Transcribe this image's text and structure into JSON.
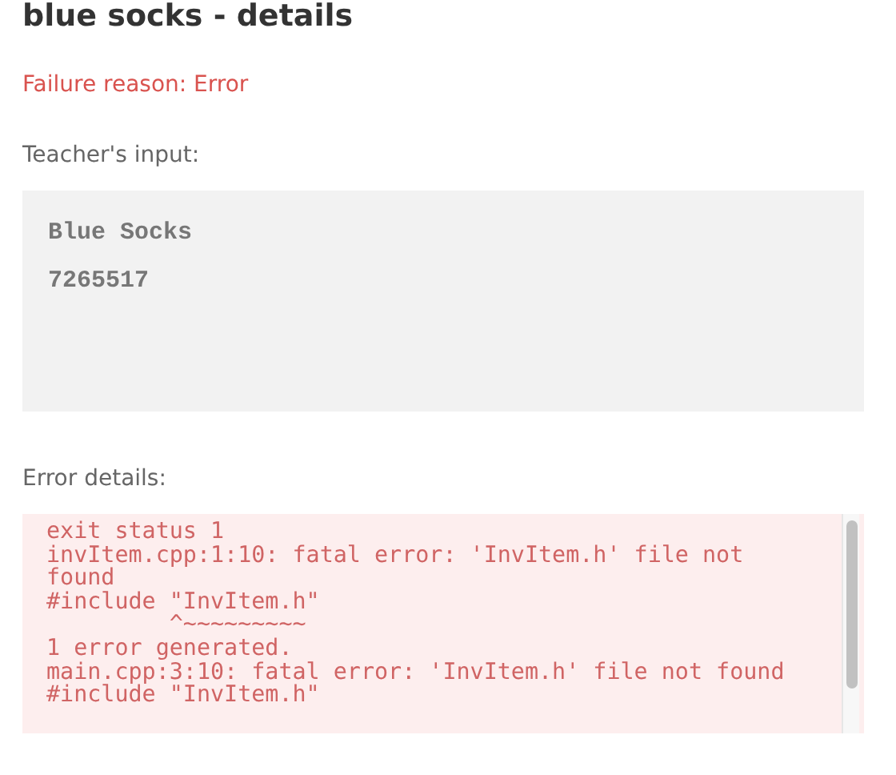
{
  "title": "blue socks - details",
  "failure_reason": "Failure reason: Error",
  "teacher_input": {
    "label": "Teacher's input:",
    "lines": [
      "Blue Socks",
      "7265517"
    ]
  },
  "error_details": {
    "label": "Error details:",
    "lines": [
      "exit status 1",
      "invItem.cpp:1:10: fatal error: 'InvItem.h' file not found",
      "#include \"InvItem.h\"",
      "         ^~~~~~~~~~",
      "1 error generated.",
      "main.cpp:3:10: fatal error: 'InvItem.h' file not found",
      "#include \"InvItem.h\""
    ]
  }
}
